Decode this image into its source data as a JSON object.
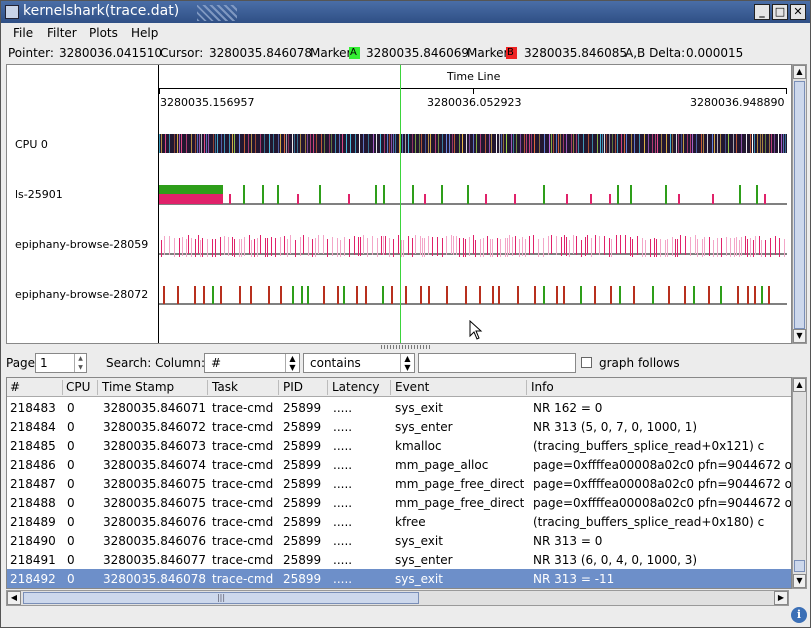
{
  "window": {
    "title": "kernelshark(trace.dat)",
    "minimize_glyph": "_",
    "maximize_glyph": "□",
    "close_glyph": "✕"
  },
  "menu": {
    "items": [
      "File",
      "Filter",
      "Plots",
      "Help"
    ]
  },
  "info": {
    "pointer_label": "Pointer:",
    "pointer_value": "3280036.041510",
    "cursor_label": "Cursor:",
    "cursor_value": "3280035.846078",
    "marker_a_label": "Marker",
    "marker_a_tag": "A",
    "marker_a_value": "3280035.846069",
    "marker_b_label": "Marker",
    "marker_b_tag": "B",
    "marker_b_value": "3280035.846085",
    "delta_label": "A,B Delta:",
    "delta_value": "0.000015",
    "marker_a_color": "#33ee33",
    "marker_b_color": "#ee2222"
  },
  "graph": {
    "timeline_label": "Time Line",
    "tick_labels": [
      "3280035.156957",
      "3280036.052923",
      "3280036.948890"
    ],
    "rows": [
      "CPU 0",
      "ls-25901",
      "epiphany-browse-28059",
      "epiphany-browse-28072"
    ],
    "cursor_color": "#3bd43b"
  },
  "search": {
    "page_label": "Page",
    "page_value": "1",
    "search_label": "Search: Column:",
    "column_value": "#",
    "mode_value": "contains",
    "query_value": "",
    "graph_follows_label": "graph follows"
  },
  "table": {
    "columns": [
      "#",
      "CPU",
      "Time Stamp",
      "Task",
      "PID",
      "Latency",
      "Event",
      "Info"
    ],
    "rows": [
      [
        "218483",
        "0",
        "3280035.846071",
        "trace-cmd",
        "25899",
        ".....",
        "sys_exit",
        "NR 162 = 0"
      ],
      [
        "218484",
        "0",
        "3280035.846072",
        "trace-cmd",
        "25899",
        ".....",
        "sys_enter",
        "NR 313 (5, 0, 7, 0, 1000, 1)"
      ],
      [
        "218485",
        "0",
        "3280035.846073",
        "trace-cmd",
        "25899",
        ".....",
        "kmalloc",
        "(tracing_buffers_splice_read+0x121) c"
      ],
      [
        "218486",
        "0",
        "3280035.846074",
        "trace-cmd",
        "25899",
        ".....",
        "mm_page_alloc",
        "page=0xffffea00008a02c0 pfn=9044672 o"
      ],
      [
        "218487",
        "0",
        "3280035.846075",
        "trace-cmd",
        "25899",
        ".....",
        "mm_page_free_direct",
        "page=0xffffea00008a02c0 pfn=9044672 o"
      ],
      [
        "218488",
        "0",
        "3280035.846075",
        "trace-cmd",
        "25899",
        ".....",
        "mm_page_free_direct",
        "page=0xffffea00008a02c0 pfn=9044672 o"
      ],
      [
        "218489",
        "0",
        "3280035.846076",
        "trace-cmd",
        "25899",
        ".....",
        "kfree",
        "(tracing_buffers_splice_read+0x180) c"
      ],
      [
        "218490",
        "0",
        "3280035.846076",
        "trace-cmd",
        "25899",
        ".....",
        "sys_exit",
        "NR 313 = 0"
      ],
      [
        "218491",
        "0",
        "3280035.846077",
        "trace-cmd",
        "25899",
        ".....",
        "sys_enter",
        "NR 313 (6, 0, 4, 0, 1000, 3)"
      ],
      [
        "218492",
        "0",
        "3280035.846078",
        "trace-cmd",
        "25899",
        ".....",
        "sys_exit",
        "NR 313 = -11"
      ]
    ],
    "selected_index": 9,
    "selection_color": "#6d8fc9"
  },
  "icons": {
    "info": "info-icon",
    "mouse": "mouse-pointer-icon"
  }
}
